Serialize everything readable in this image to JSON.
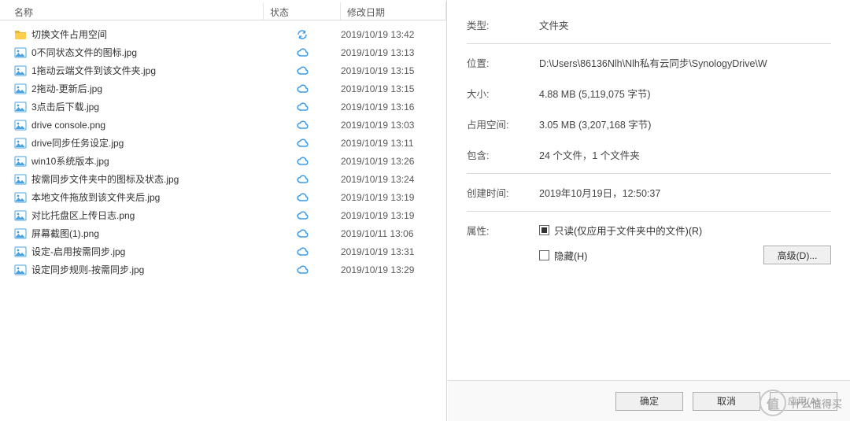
{
  "columns": {
    "name": "名称",
    "status": "状态",
    "date": "修改日期"
  },
  "files": [
    {
      "icon": "folder",
      "name": "切换文件占用空间",
      "status": "sync",
      "date": "2019/10/19 13:42"
    },
    {
      "icon": "img",
      "name": "0不同状态文件的图标.jpg",
      "status": "cloud",
      "date": "2019/10/19 13:13"
    },
    {
      "icon": "img",
      "name": "1拖动云端文件到该文件夹.jpg",
      "status": "cloud",
      "date": "2019/10/19 13:15"
    },
    {
      "icon": "img",
      "name": "2拖动-更新后.jpg",
      "status": "cloud",
      "date": "2019/10/19 13:15"
    },
    {
      "icon": "img",
      "name": "3点击后下载.jpg",
      "status": "cloud",
      "date": "2019/10/19 13:16"
    },
    {
      "icon": "img",
      "name": "drive console.png",
      "status": "cloud",
      "date": "2019/10/19 13:03"
    },
    {
      "icon": "img",
      "name": "drive同步任务设定.jpg",
      "status": "cloud",
      "date": "2019/10/19 13:11"
    },
    {
      "icon": "img",
      "name": "win10系统版本.jpg",
      "status": "cloud",
      "date": "2019/10/19 13:26"
    },
    {
      "icon": "img",
      "name": "按需同步文件夹中的图标及状态.jpg",
      "status": "cloud",
      "date": "2019/10/19 13:24"
    },
    {
      "icon": "img",
      "name": "本地文件拖放到该文件夹后.jpg",
      "status": "cloud",
      "date": "2019/10/19 13:19"
    },
    {
      "icon": "img",
      "name": "对比托盘区上传日志.png",
      "status": "cloud",
      "date": "2019/10/19 13:19"
    },
    {
      "icon": "img",
      "name": "屏幕截图(1).png",
      "status": "cloud",
      "date": "2019/10/11 13:06"
    },
    {
      "icon": "img",
      "name": "设定-启用按需同步.jpg",
      "status": "cloud",
      "date": "2019/10/19 13:31"
    },
    {
      "icon": "img",
      "name": "设定同步规则-按需同步.jpg",
      "status": "cloud",
      "date": "2019/10/19 13:29"
    }
  ],
  "props": {
    "type_label": "类型:",
    "type_value": "文件夹",
    "loc_label": "位置:",
    "loc_value": "D:\\Users\\86136Nlh\\Nlh私有云同步\\SynologyDrive\\W",
    "size_label": "大小:",
    "size_value": "4.88 MB (5,119,075 字节)",
    "disk_label": "占用空间:",
    "disk_value": "3.05 MB (3,207,168 字节)",
    "cont_label": "包含:",
    "cont_value": "24 个文件，1 个文件夹",
    "ctime_label": "创建时间:",
    "ctime_value": "2019年10月19日，12:50:37",
    "attr_label": "属性:",
    "readonly": "只读(仅应用于文件夹中的文件)(R)",
    "hidden": "隐藏(H)",
    "advanced": "高级(D)...",
    "ok": "确定",
    "cancel": "取消",
    "apply": "应用(A)"
  },
  "watermark": "什么值得买"
}
